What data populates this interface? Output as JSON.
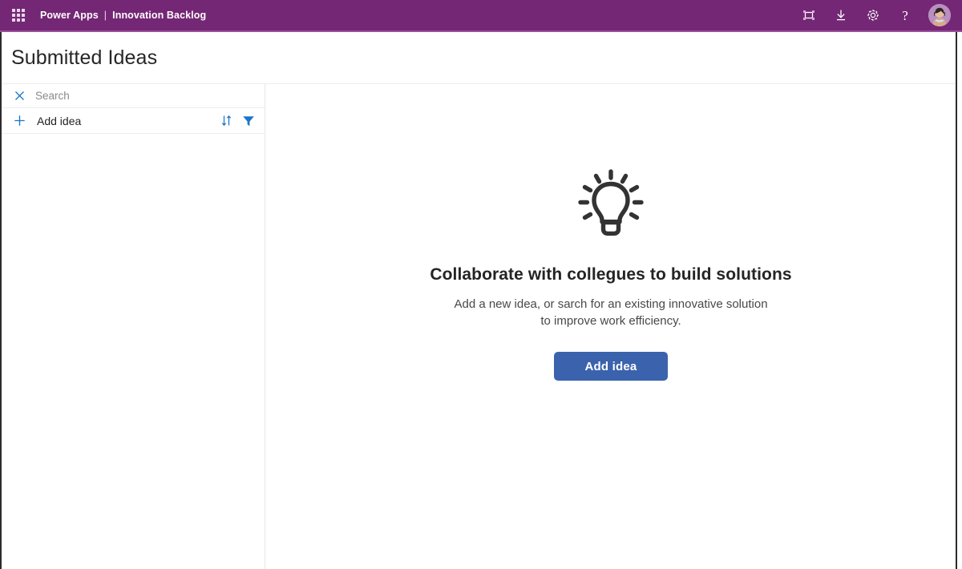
{
  "topbar": {
    "waffle_label": "app-launcher",
    "product": "Power Apps",
    "separator": "|",
    "app_name": "Innovation Backlog",
    "actions": [
      {
        "name": "edit-frame-icon",
        "label": "Edit"
      },
      {
        "name": "download-icon",
        "label": "Download"
      },
      {
        "name": "gear-icon",
        "label": "Settings"
      },
      {
        "name": "help-icon",
        "label": "?"
      }
    ],
    "help_glyph": "?",
    "avatar_label": "User account",
    "background_color": "#742774",
    "underline_color": "#9a4f9a"
  },
  "page": {
    "title": "Submitted Ideas"
  },
  "sidebar": {
    "search": {
      "clear_icon": "close-icon",
      "placeholder": "Search",
      "value": ""
    },
    "add_idea": {
      "plus_icon": "plus-icon",
      "label": "Add idea",
      "sort_icon": "sort-icon",
      "filter_icon": "filter-icon"
    },
    "items": []
  },
  "main": {
    "illustration": "lightbulb-icon",
    "heading": "Collaborate with collegues to build solutions",
    "subtext": "Add a new idea, or sarch for an existing innovative solution to improve work efficiency.",
    "primary_button": "Add idea",
    "button_color": "#3b63ad"
  }
}
